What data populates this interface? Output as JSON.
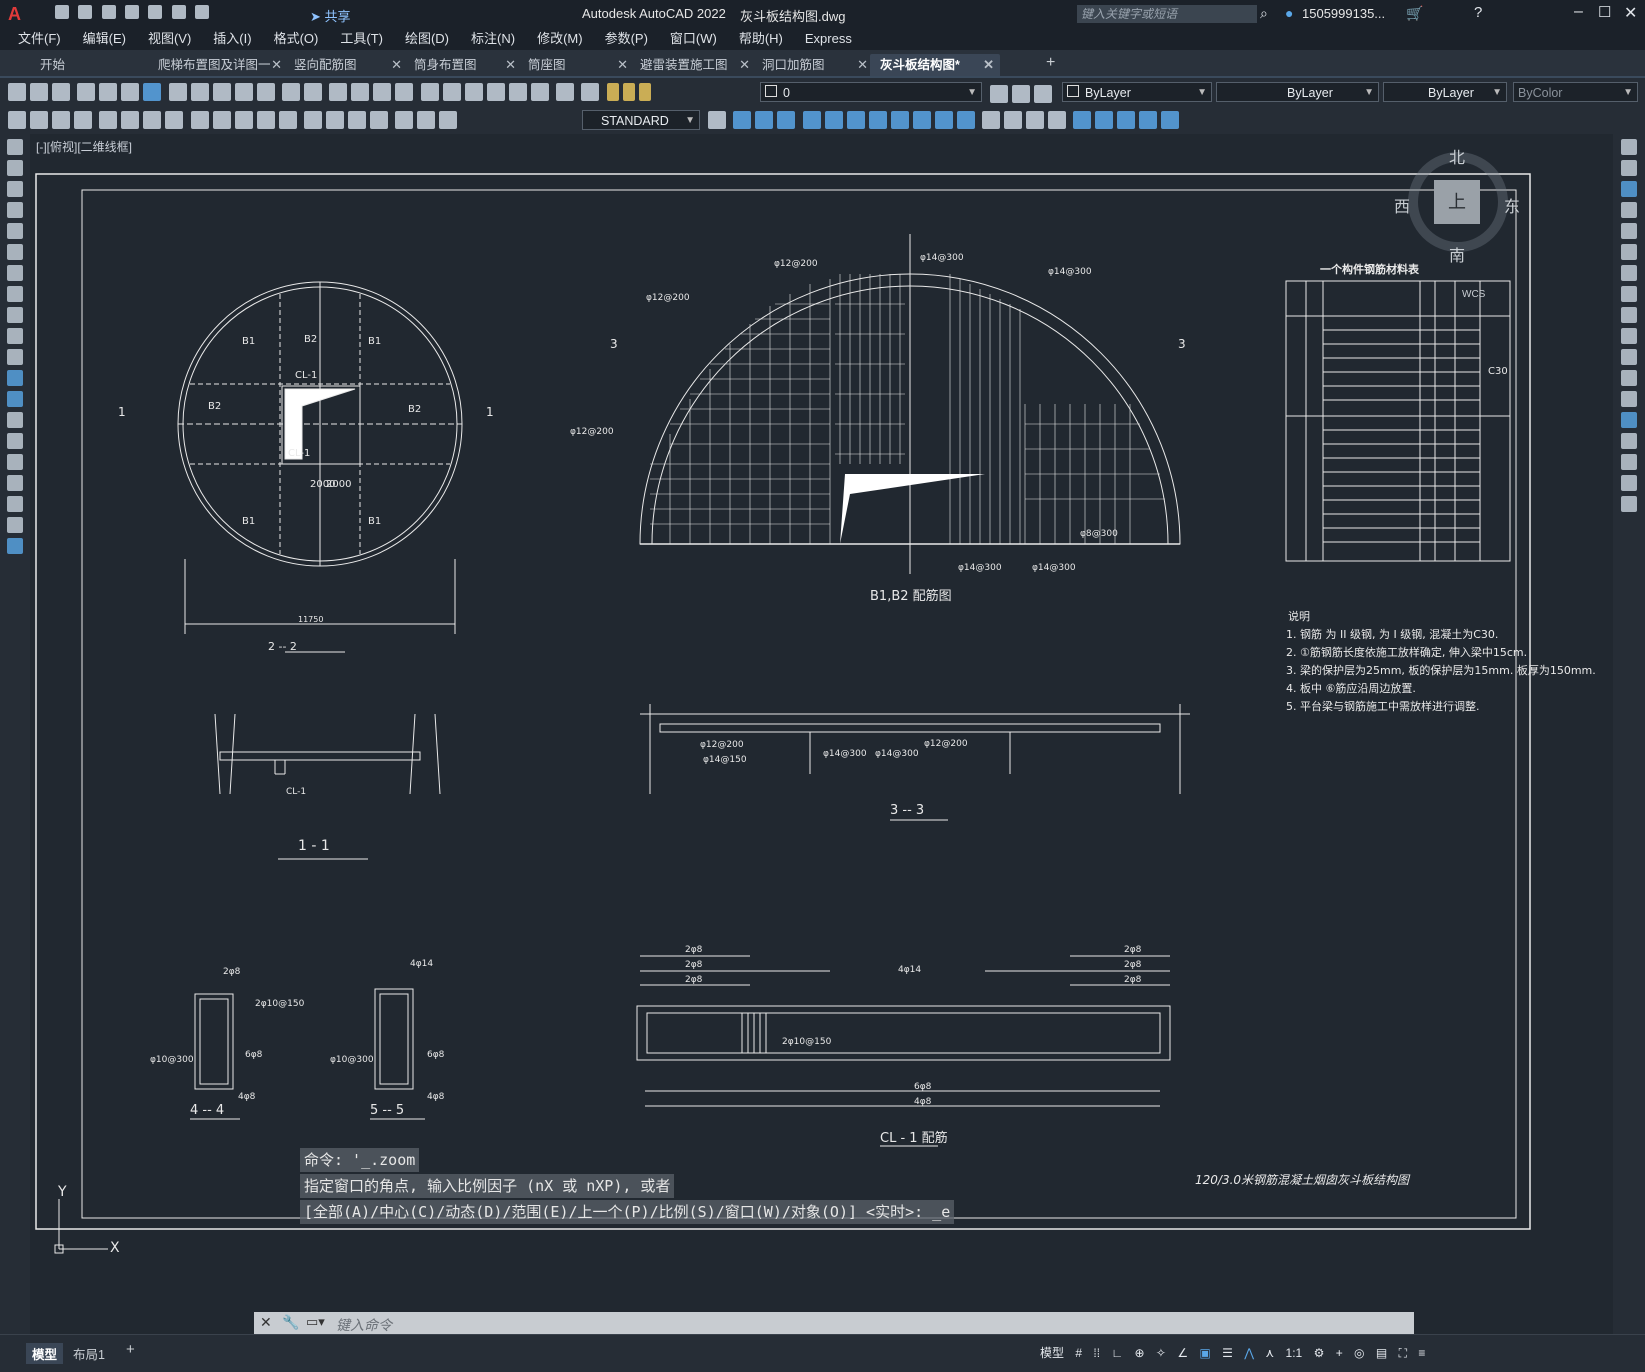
{
  "title_bar": {
    "app_title": "Autodesk AutoCAD 2022",
    "file_name": "灰斗板结构图.dwg",
    "share_label": "共享",
    "search_placeholder": "键入关键字或短语",
    "user": "1505999135...",
    "window_controls": [
      "minimize-icon",
      "maximize-icon",
      "close-icon"
    ]
  },
  "menu": {
    "items": [
      "文件(F)",
      "编辑(E)",
      "视图(V)",
      "插入(I)",
      "格式(O)",
      "工具(T)",
      "绘图(D)",
      "标注(N)",
      "修改(M)",
      "参数(P)",
      "窗口(W)",
      "帮助(H)",
      "Express"
    ]
  },
  "tabs": [
    {
      "label": "开始",
      "active": false
    },
    {
      "label": "爬梯布置图及详图一",
      "active": false
    },
    {
      "label": "竖向配筋图",
      "active": false
    },
    {
      "label": "筒身布置图",
      "active": false
    },
    {
      "label": "筒座图",
      "active": false
    },
    {
      "label": "避雷装置施工图",
      "active": false
    },
    {
      "label": "洞口加筋图",
      "active": false
    },
    {
      "label": "灰斗板结构图*",
      "active": true
    }
  ],
  "properties": {
    "layer": "0",
    "color": "ByLayer",
    "linetype": "ByLayer",
    "lineweight": "ByLayer",
    "plotstyle": "ByColor",
    "text_style": "STANDARD"
  },
  "viewport_label": "[-][俯视][二维线框]",
  "viewcube": {
    "north": "北",
    "south": "南",
    "east": "东",
    "west": "西",
    "face": "上",
    "wcs": "WCS"
  },
  "drawing": {
    "section_labels": {
      "s1": "1 - 1",
      "s2": "2 -- 2",
      "s3": "3 -- 3",
      "s4": "4 -- 4",
      "s5": "5 -- 5",
      "b1b2": "B1,B2 配筋图",
      "cl1": "CL - 1 配筋"
    },
    "table_title": "一个构件钢筋材料表",
    "table_concrete": "C30",
    "notes_title": "说明",
    "notes": [
      "1. 钢筋 为 II 级钢, 为 I 级钢, 混凝土为C30.",
      "2. ①筋钢筋长度依施工放样确定, 伸入梁中15cm.",
      "3. 梁的保护层为25mm, 板的保护层为15mm. 板厚为150mm.",
      "4. 板中 ⑥筋应沿周边放置.",
      "5. 平台梁与钢筋施工中需放样进行调整."
    ],
    "title_block": "120/3.0米钢筋混凝土烟囱灰斗板结构图",
    "dim_11750": "11750",
    "rebar_labels": [
      "φ12@200",
      "φ14@300",
      "φ14@150",
      "φ8@300",
      "2φ8",
      "4φ14",
      "2φ10@150",
      "6φ8",
      "4φ8",
      "φ10@300"
    ]
  },
  "command": {
    "line1": "命令: '_.zoom",
    "line2": "指定窗口的角点, 输入比例因子 (nX 或 nXP), 或者",
    "line3": "[全部(A)/中心(C)/动态(D)/范围(E)/上一个(P)/比例(S)/窗口(W)/对象(O)] <实时>: _e",
    "placeholder": "键入命令"
  },
  "status": {
    "layout_tabs": [
      "模型",
      "布局1"
    ],
    "mode": "模型",
    "scale": "1:1"
  }
}
